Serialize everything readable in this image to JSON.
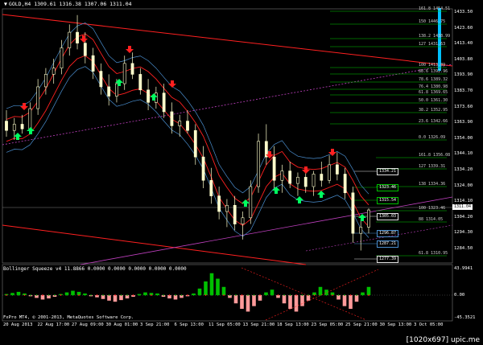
{
  "chart_title": "GOLD,H4  1309.61 1316.38 1307.06 1311.04",
  "indicator_title": "Bollinger Squeeze v4 11.8866 0.0000 0.0000 0.0000 0.0000 0.0000",
  "footer_text": "FxPro MT4, © 2001-2013, MetaQuotes Software Corp.",
  "watermark": "[1020x697] upic.me",
  "current_price": "1311.04",
  "colors": {
    "background": "#000000",
    "candle": "#ffffcc",
    "channel": "#ff2020",
    "bollinger_outer": "#4a8fd0",
    "bollinger_inner": "#ff2020",
    "fib": "#00cc00",
    "dotted": "#c040c0",
    "osc_up": "#00c000",
    "osc_down": "#ff9a9a",
    "arrow_up": "#00ff60",
    "arrow_down": "#ff2020",
    "cyan_bar": "#00c0ff"
  },
  "x_labels": [
    "20 Aug 2013",
    "22 Aug 17:00",
    "27 Aug 09:00",
    "30 Aug 01:00",
    "3 Sep 21:00",
    "6 Sep 13:00",
    "11 Sep 05:00",
    "13 Sep 21:00",
    "18 Sep 13:00",
    "23 Sep 05:00",
    "25 Sep 21:00",
    "30 Sep 13:00",
    "3 Oct 05:00"
  ],
  "y_labels": [
    "1433.50",
    "1423.60",
    "1413.40",
    "1403.80",
    "1393.90",
    "1383.70",
    "1373.60",
    "1363.90",
    "1354.00",
    "1344.10",
    "1334.20",
    "1324.00",
    "1314.10",
    "1304.20",
    "1294.30",
    "1284.50"
  ],
  "osc_labels": [
    "43.9941",
    "0.00",
    "-45.3521"
  ],
  "fib_levels": [
    "161.8  1454.51",
    "150  1446.75",
    "138.2  1438.99",
    "127  1431.63",
    "100  1413.89",
    "88.6  1392.96",
    "78.6  1389.32",
    "76.4  1380.98",
    "61.8  1369.65",
    "50.0  1361.30",
    "38.2  1352.95",
    "23.6  1342.66",
    "0.0  1326.09",
    "161.8  1356.08",
    "127  1339.31",
    "138  1334.36",
    "100  1323.46",
    "88  1314.05",
    "61.8  1310.95"
  ],
  "price_boxes": [
    "1334.21",
    "1323.46",
    "1315.54",
    "1305.03",
    "1296.87",
    "1287.21",
    "1277.39"
  ],
  "chart_data": {
    "type": "candlestick",
    "title": "GOLD,H4  1309.61 1316.38 1307.06 1311.04",
    "ylim": [
      1277,
      1440
    ],
    "candles": [
      [
        1368,
        1375,
        1358,
        1362
      ],
      [
        1362,
        1370,
        1356,
        1366
      ],
      [
        1366,
        1372,
        1360,
        1363
      ],
      [
        1363,
        1380,
        1360,
        1376
      ],
      [
        1376,
        1395,
        1372,
        1390
      ],
      [
        1390,
        1402,
        1385,
        1398
      ],
      [
        1398,
        1408,
        1392,
        1402
      ],
      [
        1402,
        1420,
        1398,
        1415
      ],
      [
        1415,
        1430,
        1410,
        1425
      ],
      [
        1425,
        1436,
        1414,
        1418
      ],
      [
        1418,
        1425,
        1405,
        1410
      ],
      [
        1410,
        1415,
        1395,
        1400
      ],
      [
        1400,
        1405,
        1385,
        1390
      ],
      [
        1390,
        1398,
        1378,
        1384
      ],
      [
        1384,
        1395,
        1380,
        1392
      ],
      [
        1392,
        1410,
        1388,
        1405
      ],
      [
        1405,
        1412,
        1395,
        1398
      ],
      [
        1398,
        1402,
        1385,
        1388
      ],
      [
        1388,
        1395,
        1375,
        1380
      ],
      [
        1380,
        1390,
        1376,
        1386
      ],
      [
        1386,
        1392,
        1370,
        1374
      ],
      [
        1374,
        1380,
        1360,
        1365
      ],
      [
        1365,
        1372,
        1358,
        1368
      ],
      [
        1368,
        1375,
        1360,
        1362
      ],
      [
        1362,
        1366,
        1340,
        1345
      ],
      [
        1345,
        1352,
        1325,
        1330
      ],
      [
        1330,
        1338,
        1315,
        1320
      ],
      [
        1320,
        1326,
        1305,
        1310
      ],
      [
        1310,
        1318,
        1300,
        1314
      ],
      [
        1314,
        1320,
        1298,
        1302
      ],
      [
        1302,
        1310,
        1292,
        1306
      ],
      [
        1306,
        1330,
        1302,
        1326
      ],
      [
        1326,
        1360,
        1322,
        1355
      ],
      [
        1355,
        1366,
        1340,
        1345
      ],
      [
        1345,
        1352,
        1325,
        1330
      ],
      [
        1330,
        1340,
        1322,
        1336
      ],
      [
        1336,
        1342,
        1325,
        1328
      ],
      [
        1328,
        1335,
        1320,
        1332
      ],
      [
        1332,
        1338,
        1322,
        1326
      ],
      [
        1326,
        1336,
        1320,
        1334
      ],
      [
        1334,
        1342,
        1326,
        1330
      ],
      [
        1330,
        1346,
        1328,
        1340
      ],
      [
        1340,
        1348,
        1330,
        1334
      ],
      [
        1334,
        1338,
        1318,
        1322
      ],
      [
        1322,
        1326,
        1290,
        1296
      ],
      [
        1296,
        1305,
        1285,
        1300
      ],
      [
        1300,
        1312,
        1296,
        1311
      ]
    ],
    "x_tick_labels": [
      "20 Aug 2013",
      "22 Aug 17:00",
      "27 Aug 09:00",
      "30 Aug 01:00",
      "3 Sep 21:00",
      "6 Sep 13:00",
      "11 Sep 05:00",
      "13 Sep 21:00",
      "18 Sep 13:00",
      "23 Sep 05:00",
      "25 Sep 21:00",
      "30 Sep 13:00",
      "3 Oct 05:00"
    ],
    "y_tick_labels": [
      "1433.50",
      "1423.60",
      "1413.40",
      "1403.80",
      "1393.90",
      "1383.70",
      "1373.60",
      "1363.90",
      "1354.00",
      "1344.10",
      "1334.20",
      "1324.00",
      "1314.10",
      "1304.20",
      "1294.30",
      "1284.50"
    ],
    "oscillator": [
      2,
      4,
      6,
      3,
      -2,
      -5,
      -8,
      -6,
      -3,
      2,
      5,
      8,
      6,
      3,
      -2,
      -4,
      -7,
      -10,
      -12,
      -9,
      -6,
      -3,
      2,
      5,
      4,
      3,
      -3,
      -6,
      -8,
      -5,
      -2,
      3,
      12,
      25,
      40,
      30,
      15,
      -5,
      -15,
      -25,
      -30,
      -20,
      -10,
      5,
      10,
      -5,
      -15,
      -25,
      -30,
      -20,
      -10,
      5,
      15,
      10,
      5,
      -8,
      -20,
      -25,
      -12,
      5,
      15
    ],
    "osc_ylim": [
      -45.3521,
      43.9941
    ]
  }
}
